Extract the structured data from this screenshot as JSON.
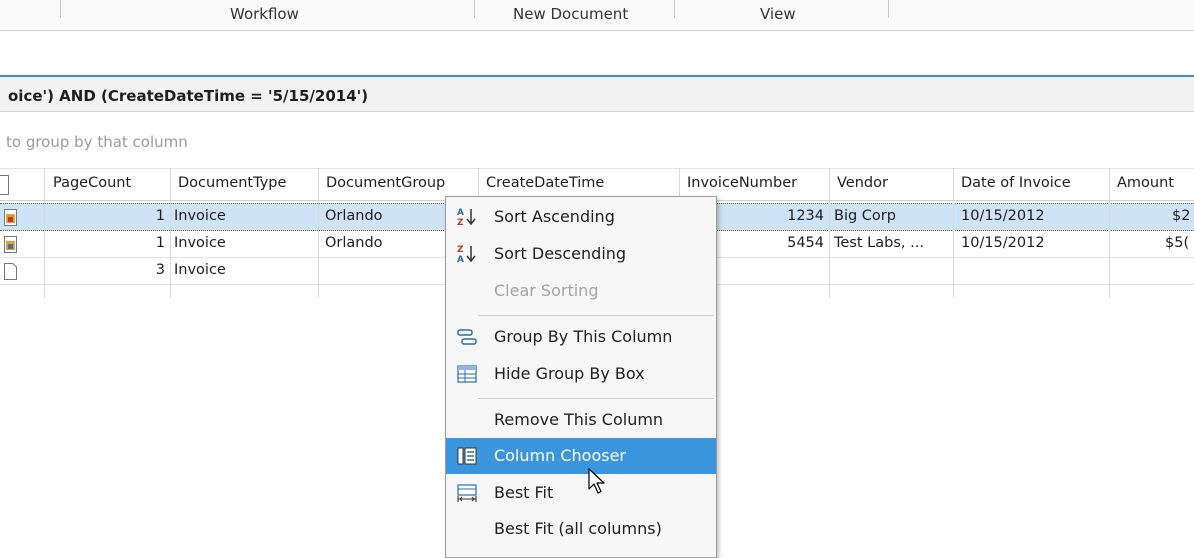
{
  "ribbon": {
    "groups": [
      "Workflow",
      "New Document",
      "View"
    ]
  },
  "filter": {
    "text": "oice') AND (CreateDateTime = '5/15/2014')"
  },
  "group_by_hint": "to group by that column",
  "grid": {
    "columns": [
      "PageCount",
      "DocumentType",
      "DocumentGroup",
      "CreateDateTime",
      "InvoiceNumber",
      "Vendor",
      "Date of Invoice",
      "Amount"
    ],
    "rows": [
      {
        "pagecount": "1",
        "doctype": "Invoice",
        "docgroup": "Orlando",
        "invoice_no": "1234",
        "vendor": "Big Corp",
        "date": "10/15/2012",
        "amount": "$2"
      },
      {
        "pagecount": "1",
        "doctype": "Invoice",
        "docgroup": "Orlando",
        "invoice_no": "5454",
        "vendor": "Test Labs, ...",
        "date": "10/15/2012",
        "amount": "$5("
      },
      {
        "pagecount": "3",
        "doctype": "Invoice",
        "docgroup": "",
        "invoice_no": "",
        "vendor": "",
        "date": "",
        "amount": ""
      }
    ]
  },
  "context_menu": {
    "items": [
      {
        "label": "Sort Ascending",
        "icon": "sort-ascending-icon"
      },
      {
        "label": "Sort Descending",
        "icon": "sort-descending-icon"
      },
      {
        "label": "Clear Sorting",
        "disabled": true
      },
      {
        "label": "Group By This Column",
        "icon": "group-by-icon"
      },
      {
        "label": "Hide Group By Box",
        "icon": "group-box-icon"
      },
      {
        "label": "Remove This Column"
      },
      {
        "label": "Column Chooser",
        "icon": "column-chooser-icon",
        "highlighted": true
      },
      {
        "label": "Best Fit",
        "icon": "best-fit-icon"
      },
      {
        "label": "Best Fit (all columns)"
      }
    ]
  },
  "colors": {
    "selection": "#cfe3f6",
    "menu_highlight": "#3a95dd",
    "accent_line": "#3c8ccc"
  }
}
